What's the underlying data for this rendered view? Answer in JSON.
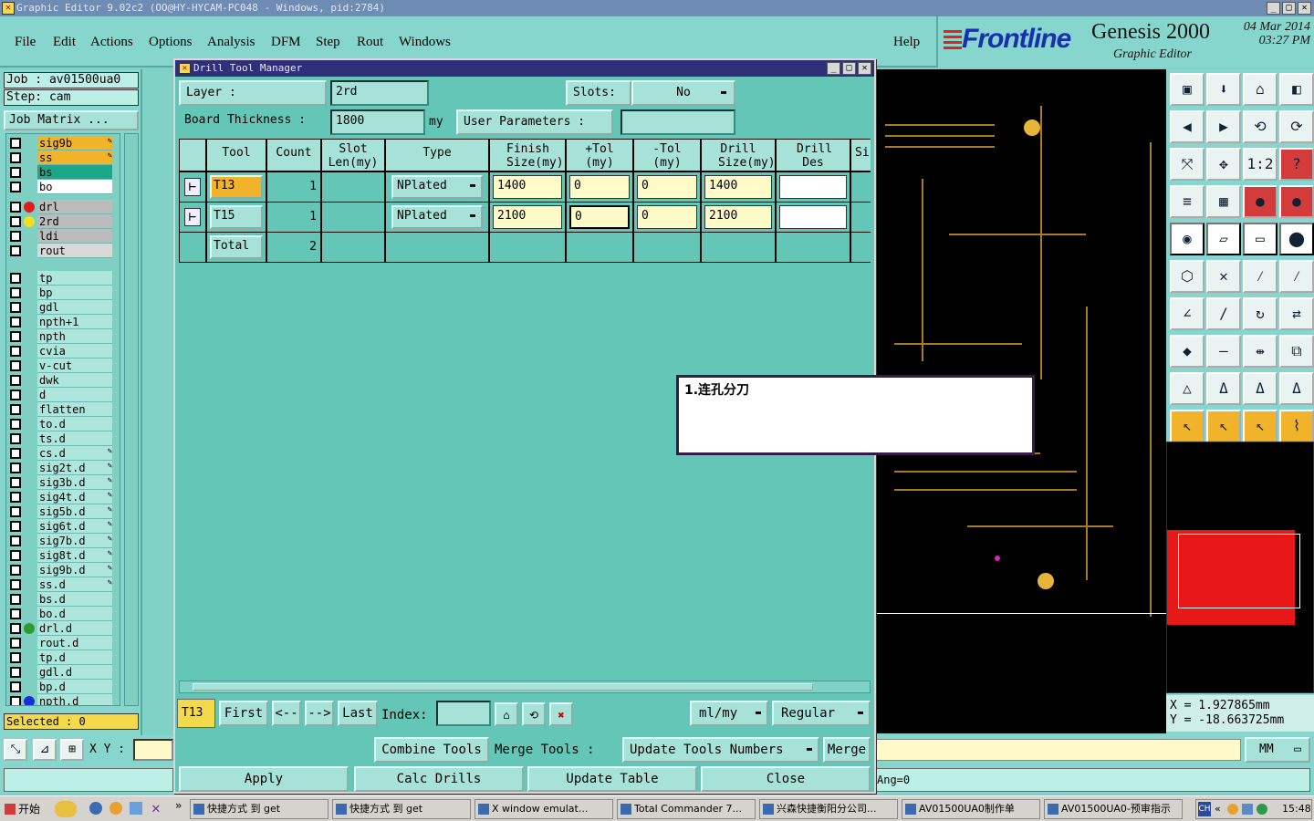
{
  "window_title": "Graphic Editor 9.02c2 (OO@HY-HYCAM-PC048 - Windows, pid:2784)",
  "menu": [
    "File",
    "Edit",
    "Actions",
    "Options",
    "Analysis",
    "DFM",
    "Step",
    "Rout",
    "Windows"
  ],
  "help_label": "Help",
  "brand": {
    "logo": "Frontline",
    "product": "Genesis 2000",
    "subtitle": "Graphic Editor",
    "date": "04 Mar 2014",
    "time": "03:27 PM",
    "accent": "#e0231b",
    "logo_color": "#1a2fb0"
  },
  "job_line": "Job : av01500ua0",
  "step_line": "Step: cam",
  "job_matrix_label": "Job Matrix ...",
  "selected_label": "Selected : 0",
  "layers": [
    {
      "name": "sig9b",
      "color": "#f1b32a",
      "edit": true
    },
    {
      "name": "ss",
      "color": "#f1b32a",
      "edit": true
    },
    {
      "name": "bs",
      "color": "#1aa888"
    },
    {
      "name": "bo",
      "color": "#ffffff"
    },
    {
      "name": "drl",
      "dot": "#e31b1b",
      "color": "#bcbcbc"
    },
    {
      "name": "2rd",
      "dot": "#f0e020",
      "color": "#bcbcbc"
    },
    {
      "name": "ldi",
      "color": "#bcbcbc"
    },
    {
      "name": "rout",
      "color": "#d8d8d8"
    },
    {
      "name": "tp"
    },
    {
      "name": "bp"
    },
    {
      "name": "gdl"
    },
    {
      "name": "npth+1"
    },
    {
      "name": "npth"
    },
    {
      "name": "cvia"
    },
    {
      "name": "v-cut"
    },
    {
      "name": "dwk"
    },
    {
      "name": "d"
    },
    {
      "name": "flatten"
    },
    {
      "name": "to.d"
    },
    {
      "name": "ts.d"
    },
    {
      "name": "cs.d",
      "edit": true
    },
    {
      "name": "sig2t.d",
      "edit": true
    },
    {
      "name": "sig3b.d",
      "edit": true
    },
    {
      "name": "sig4t.d",
      "edit": true
    },
    {
      "name": "sig5b.d",
      "edit": true
    },
    {
      "name": "sig6t.d",
      "edit": true
    },
    {
      "name": "sig7b.d",
      "edit": true
    },
    {
      "name": "sig8t.d",
      "edit": true
    },
    {
      "name": "sig9b.d",
      "edit": true
    },
    {
      "name": "ss.d",
      "edit": true
    },
    {
      "name": "bs.d"
    },
    {
      "name": "bo.d"
    },
    {
      "name": "drl.d",
      "dot": "#2f9a2f"
    },
    {
      "name": "rout.d"
    },
    {
      "name": "tp.d"
    },
    {
      "name": "gdl.d"
    },
    {
      "name": "bp.d"
    },
    {
      "name": "npth.d",
      "dot": "#1a2fd8"
    }
  ],
  "xy_label": "X Y :",
  "coords": {
    "x": "X = 1.927865mm",
    "y": "Y = -18.663725mm"
  },
  "units_mm": "MM",
  "status_text": "Ang=0",
  "dialog": {
    "title": "Drill Tool Manager",
    "layer_label": "Layer :",
    "layer_value": "2rd",
    "slots_label": "Slots:",
    "slots_value": "No",
    "thickness_label": "Board Thickness :",
    "thickness_value": "1800",
    "thickness_unit": "my",
    "user_params_label": "User Parameters :",
    "user_params_value": "",
    "headers": [
      "Tool",
      "Count",
      "Slot Len(my)",
      "Type",
      "Finish Size(my)",
      "+Tol (my)",
      "-Tol (my)",
      "Drill Size(my)",
      "Drill Des",
      "Si"
    ],
    "rows": [
      {
        "tool": "T13",
        "count": "1",
        "slot": "",
        "type": "NPlated",
        "finish": "1400",
        "ptol": "0",
        "ntol": "0",
        "drill": "1400",
        "des": ""
      },
      {
        "tool": "T15",
        "count": "1",
        "slot": "",
        "type": "NPlated",
        "finish": "2100",
        "ptol": "0",
        "ntol": "0",
        "drill": "2100",
        "des": ""
      }
    ],
    "total_label": "Total",
    "total_count": "2",
    "nav": {
      "current": "T13",
      "first": "First",
      "prev": "<--",
      "next": "-->",
      "last": "Last",
      "index_label": "Index:",
      "units": "ml/my",
      "mode": "Regular"
    },
    "actions": {
      "combine": "Combine Tools",
      "merge_label": "Merge Tools :",
      "update_numbers": "Update Tools Numbers",
      "merge": "Merge"
    },
    "footer": {
      "apply": "Apply",
      "calc": "Calc Drills",
      "update": "Update Table",
      "close": "Close"
    }
  },
  "popup_text": "1.连孔分刀",
  "taskbar": {
    "start": "开始",
    "items": [
      "快捷方式 到 get",
      "快捷方式 到 get",
      "X window emulat...",
      "Total Commander 7...",
      "兴森快捷衡阳分公司...",
      "AV01500UA0制作单",
      "AV01500UA0-预审指示"
    ],
    "clock": "15:48",
    "tray_label": "CH"
  }
}
